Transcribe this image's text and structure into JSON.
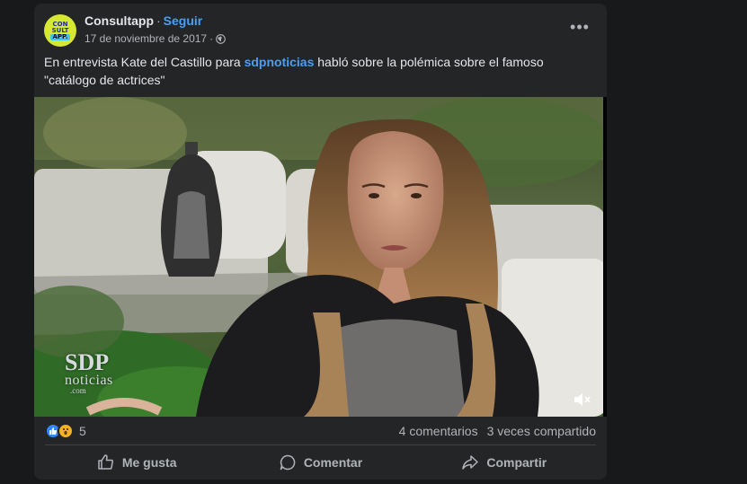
{
  "post": {
    "author": "Consultapp",
    "follow_label": "Seguir",
    "date": "17 de noviembre de 2017",
    "avatar_lines": [
      "CON",
      "SULT",
      "APP."
    ],
    "more_icon": "more-horizontal-icon",
    "audience_icon": "globe-icon",
    "caption_before": "En entrevista Kate del Castillo para ",
    "caption_link": "sdpnoticias",
    "caption_after": " habló sobre la polémica sobre el famoso \"catálogo de actrices\""
  },
  "video": {
    "watermark_main": "SDP",
    "watermark_sub": "noticias",
    "watermark_sub2": ".com",
    "mute_icon": "speaker-muted-icon"
  },
  "stats": {
    "reaction_icons": [
      "like-icon",
      "wow-icon"
    ],
    "reaction_count": "5",
    "comments": "4 comentarios",
    "shares": "3 veces compartido"
  },
  "actions": {
    "like": "Me gusta",
    "comment": "Comentar",
    "share": "Compartir"
  },
  "colors": {
    "background": "#18191a",
    "card": "#242526",
    "link": "#4a9ef5",
    "secondary_text": "#b0b3b8",
    "like_blue": "#2d88ff",
    "wow_yellow": "#f7b125"
  }
}
